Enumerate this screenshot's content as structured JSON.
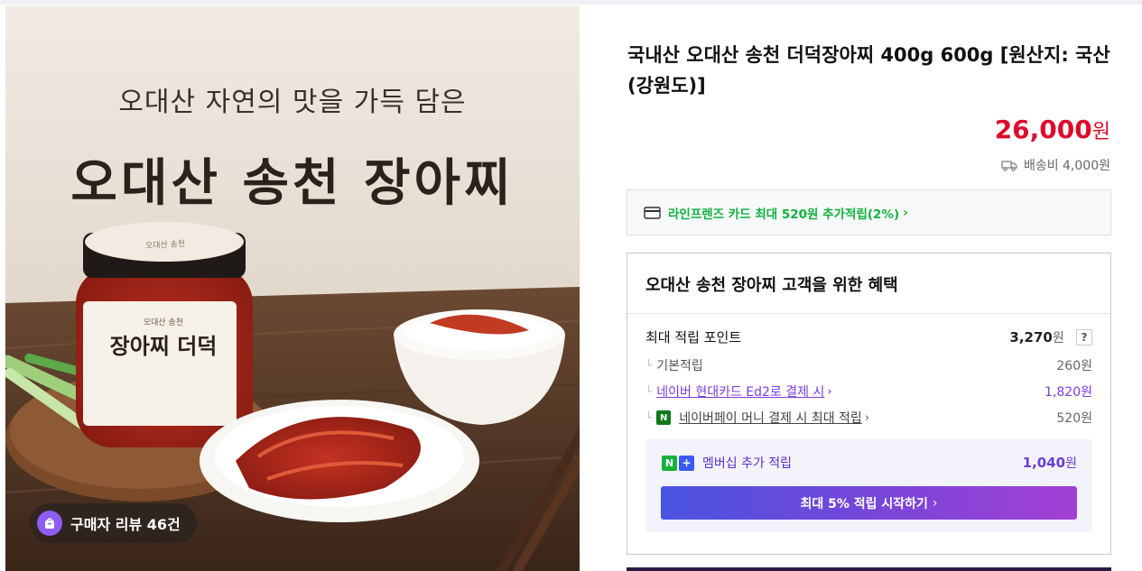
{
  "image": {
    "subtitle": "오대산 자연의 맛을 가득 담은",
    "title": "오대산 송천 장아찌",
    "jar_lid_text": "오대산 송천",
    "jar_label_small": "오대산 송천",
    "jar_label_main": "장아찌 더덕",
    "review_badge": "구매자 리뷰 46건"
  },
  "product": {
    "title": "국내산 오대산 송천 더덕장아찌 400g 600g [원산지: 국산(강원도)]",
    "price": "26,000",
    "price_unit": "원",
    "shipping": "배송비 4,000원"
  },
  "card_promo": {
    "text": "라인프렌즈 카드 최대 520원 추가적립(2%)"
  },
  "benefits": {
    "title": "오대산 송천 장아찌 고객을 위한 혜택",
    "max_points_label": "최대 적립 포인트",
    "max_points_value": "3,270",
    "won": "원",
    "help": "?",
    "basic_label": "기본적립",
    "basic_value": "260원",
    "card_label": "네이버 현대카드 Ed2로 결제 시",
    "card_value": "1,820원",
    "npay_label": "네이버페이 머니 결제 시 최대 적립",
    "npay_value": "520원",
    "npay_icon_text": "N",
    "membership_label": "멤버십 추가 적립",
    "membership_value": "1,040",
    "membership_n": "N",
    "membership_plus": "+",
    "membership_button": "최대 5% 적립 시작하기"
  },
  "colors": {
    "price": "#dd0a2a",
    "card_green": "#12b23c",
    "purple": "#7b3ce0"
  },
  "icons": [
    "truck-icon",
    "credit-card-icon",
    "review-bag-icon",
    "chevron-right-icon",
    "npay-icon"
  ]
}
